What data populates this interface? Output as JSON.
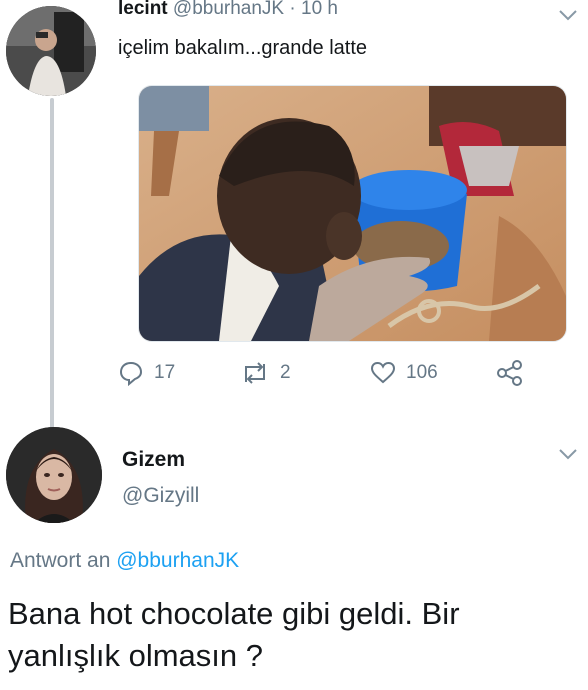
{
  "tweet": {
    "author_name": "lecint",
    "author_handle": "@bburhanJK",
    "separator": "·",
    "time": "10 h",
    "text": "içelim bakalım...grande latte",
    "stats": {
      "replies": "17",
      "retweets": "2",
      "likes": "106"
    }
  },
  "reply": {
    "author_name": "Gizem",
    "author_handle": "@Gizyill",
    "reply_prefix": "Antwort an",
    "reply_to_handle": "@bburhanJK",
    "text": "Bana hot chocolate gibi geldi. Bir yanlışlık olmasın ?"
  },
  "colors": {
    "text": "#14171a",
    "secondary": "#657786",
    "link": "#1da1f2",
    "thread_line": "#c7ccd1",
    "bowl": "#1f6fd6"
  },
  "icons": [
    "reply-icon",
    "retweet-icon",
    "like-icon",
    "share-icon",
    "chevron-down-icon"
  ]
}
